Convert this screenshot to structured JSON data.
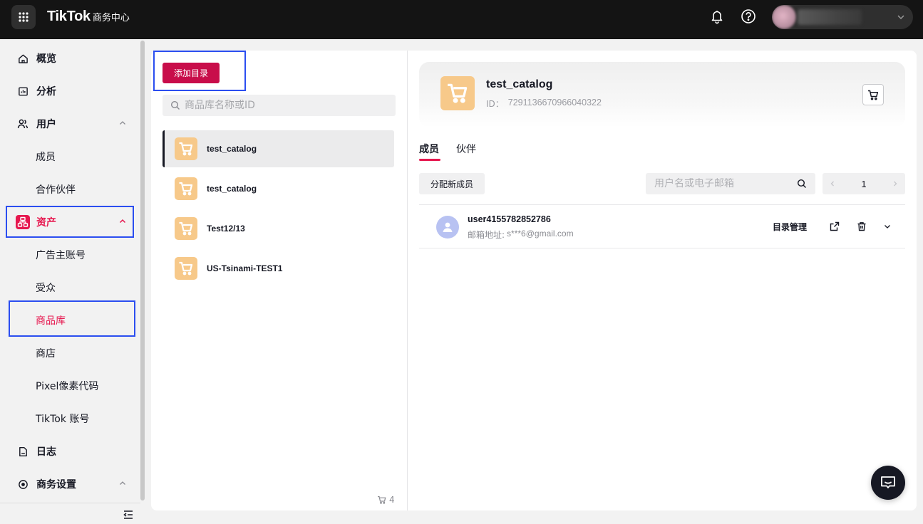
{
  "header": {
    "brand_logo": "TikTok",
    "brand_sub": "商务中心"
  },
  "sidebar": {
    "items": [
      {
        "label": "概览"
      },
      {
        "label": "分析"
      },
      {
        "label": "用户"
      },
      {
        "label": "成员"
      },
      {
        "label": "合作伙伴"
      },
      {
        "label": "资产"
      },
      {
        "label": "广告主账号"
      },
      {
        "label": "受众"
      },
      {
        "label": "商品库"
      },
      {
        "label": "商店"
      },
      {
        "label": "Pixel像素代码"
      },
      {
        "label": "TikTok 账号"
      },
      {
        "label": "日志"
      },
      {
        "label": "商务设置"
      }
    ]
  },
  "catalog_list": {
    "add_button": "添加目录",
    "search_placeholder": "商品库名称或ID",
    "items": [
      {
        "name": "test_catalog"
      },
      {
        "name": "test_catalog"
      },
      {
        "name": "Test12/13"
      },
      {
        "name": "US-Tsinami-TEST1"
      }
    ],
    "count": "4"
  },
  "detail": {
    "title": "test_catalog",
    "id_label": "ID：",
    "id_value": "7291136670966040322",
    "tabs": [
      {
        "label": "成员"
      },
      {
        "label": "伙伴"
      }
    ],
    "assign_button": "分配新成员",
    "member_search_placeholder": "用户名或电子邮箱",
    "page": "1",
    "members": [
      {
        "name": "user4155782852786",
        "email_label": "邮箱地址:",
        "email": "s***6@gmail.com",
        "manage_label": "目录管理"
      }
    ]
  },
  "colors": {
    "accent": "#e6174e",
    "primary_button": "#c80d4a",
    "catalog_thumb": "#f7c98a",
    "highlight_box": "#2b4ef0"
  }
}
